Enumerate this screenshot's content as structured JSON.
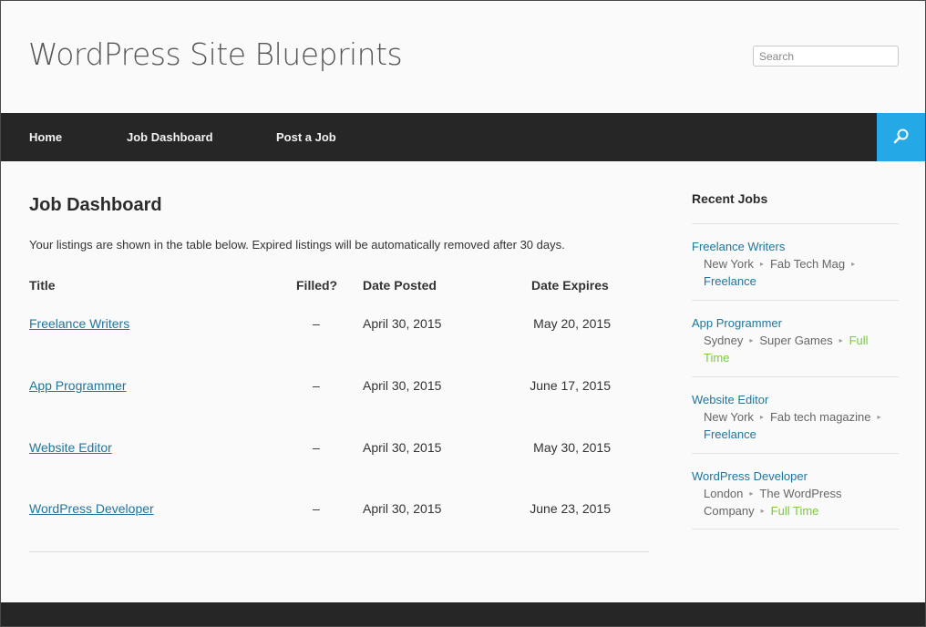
{
  "header": {
    "site_title": "WordPress Site Blueprints",
    "search_placeholder": "Search"
  },
  "nav": {
    "items": [
      {
        "label": "Home"
      },
      {
        "label": "Job Dashboard"
      },
      {
        "label": "Post a Job"
      }
    ],
    "search_icon": "search-icon",
    "accent_color": "#24a8e6"
  },
  "main": {
    "page_title": "Job Dashboard",
    "intro": "Your listings are shown in the table below. Expired listings will be automatically removed after 30 days.",
    "table": {
      "columns": [
        "Title",
        "Filled?",
        "Date Posted",
        "Date Expires"
      ],
      "rows": [
        {
          "title": "Freelance Writers",
          "filled": "–",
          "posted": "April 30, 2015",
          "expires": "May 20, 2015"
        },
        {
          "title": "App Programmer",
          "filled": "–",
          "posted": "April 30, 2015",
          "expires": "June 17, 2015"
        },
        {
          "title": "Website Editor",
          "filled": "–",
          "posted": "April 30, 2015",
          "expires": "May 30, 2015"
        },
        {
          "title": "WordPress Developer",
          "filled": "–",
          "posted": "April 30, 2015",
          "expires": "June 23, 2015"
        }
      ]
    }
  },
  "sidebar": {
    "widget_title": "Recent Jobs",
    "jobs": [
      {
        "title": "Freelance Writers",
        "meta_line1": "New York",
        "meta_line1b": "Fab Tech Mag",
        "type": "Freelance"
      },
      {
        "title": "App Programmer",
        "meta_line1": "Sydney",
        "meta_line1b": "Super Games",
        "type_a": "Full",
        "type_b": "Time"
      },
      {
        "title": "Website Editor",
        "meta_line1": "New York",
        "meta_line1b": "Fab tech magazine",
        "type": "Freelance"
      },
      {
        "title": "WordPress Developer",
        "meta_line1": "London",
        "meta_line1b": "The WordPress",
        "meta_line2": "Company",
        "type": "Full Time"
      }
    ],
    "freelance_color": "#21759b",
    "fulltime_color": "#79c943"
  }
}
